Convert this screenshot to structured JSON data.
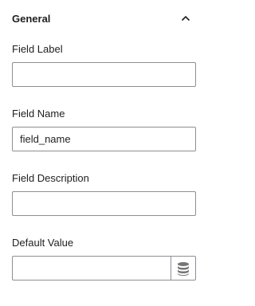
{
  "panel": {
    "title": "General",
    "toggle_icon": "chevron-up-icon"
  },
  "fields": {
    "field_label": {
      "label": "Field Label",
      "value": ""
    },
    "field_name": {
      "label": "Field Name",
      "value": "field_name"
    },
    "field_description": {
      "label": "Field Description",
      "value": ""
    },
    "default_value": {
      "label": "Default Value",
      "value": "",
      "addon_icon": "database-icon"
    }
  },
  "colors": {
    "text": "#1e1e1e",
    "border": "#8c8f94",
    "icon": "#757575"
  }
}
